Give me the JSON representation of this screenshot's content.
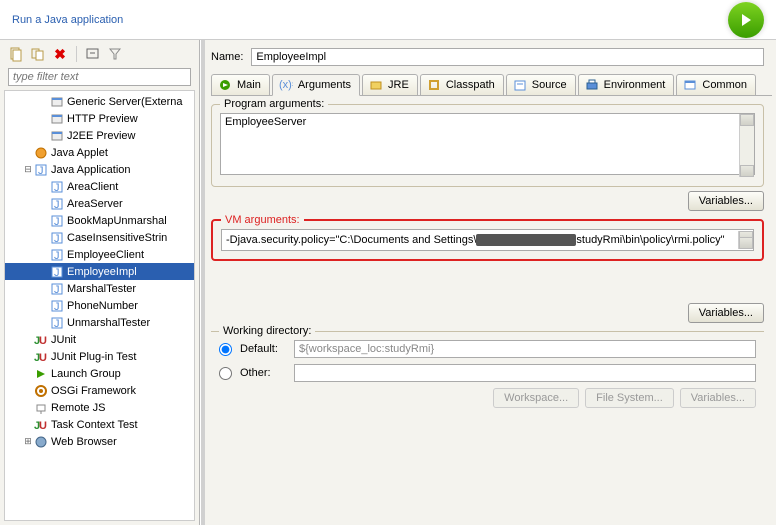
{
  "header": {
    "title": "Run a Java application"
  },
  "filter_placeholder": "type filter text",
  "tree": [
    {
      "label": "Generic Server(Externa",
      "depth": 2,
      "icon": "server"
    },
    {
      "label": "HTTP Preview",
      "depth": 2,
      "icon": "server"
    },
    {
      "label": "J2EE Preview",
      "depth": 2,
      "icon": "server"
    },
    {
      "label": "Java Applet",
      "depth": 1,
      "icon": "applet",
      "exp": ""
    },
    {
      "label": "Java Application",
      "depth": 1,
      "icon": "javaapp",
      "exp": "-"
    },
    {
      "label": "AreaClient",
      "depth": 2,
      "icon": "javarun"
    },
    {
      "label": "AreaServer",
      "depth": 2,
      "icon": "javarun"
    },
    {
      "label": "BookMapUnmarshal",
      "depth": 2,
      "icon": "javarun"
    },
    {
      "label": "CaseInsensitiveStrin",
      "depth": 2,
      "icon": "javarun"
    },
    {
      "label": "EmployeeClient",
      "depth": 2,
      "icon": "javarun"
    },
    {
      "label": "EmployeeImpl",
      "depth": 2,
      "icon": "javarun",
      "sel": true
    },
    {
      "label": "MarshalTester",
      "depth": 2,
      "icon": "javarun"
    },
    {
      "label": "PhoneNumber",
      "depth": 2,
      "icon": "javarun"
    },
    {
      "label": "UnmarshalTester",
      "depth": 2,
      "icon": "javarun"
    },
    {
      "label": "JUnit",
      "depth": 1,
      "icon": "junit",
      "exp": ""
    },
    {
      "label": "JUnit Plug-in Test",
      "depth": 1,
      "icon": "junit",
      "exp": ""
    },
    {
      "label": "Launch Group",
      "depth": 1,
      "icon": "launch",
      "exp": ""
    },
    {
      "label": "OSGi Framework",
      "depth": 1,
      "icon": "osgi",
      "exp": ""
    },
    {
      "label": "Remote JS",
      "depth": 1,
      "icon": "remote",
      "exp": ""
    },
    {
      "label": "Task Context Test",
      "depth": 1,
      "icon": "task",
      "exp": ""
    },
    {
      "label": "Web Browser",
      "depth": 1,
      "icon": "browser",
      "exp": "+"
    }
  ],
  "form": {
    "name_label": "Name:",
    "name_value": "EmployeeImpl",
    "tabs": [
      "Main",
      "Arguments",
      "JRE",
      "Classpath",
      "Source",
      "Environment",
      "Common"
    ],
    "active_tab": 1,
    "program_args_label": "Program arguments:",
    "program_args_value": "EmployeeServer",
    "vm_args_label": "VM arguments:",
    "vm_args_prefix": "-Djava.security.policy=\"C:\\Documents and Settings\\",
    "vm_args_suffix": "studyRmi\\bin\\policy\\rmi.policy\"",
    "variables_btn": "Variables...",
    "wd_label": "Working directory:",
    "wd_default": "Default:",
    "wd_default_value": "${workspace_loc:studyRmi}",
    "wd_other": "Other:",
    "workspace_btn": "Workspace...",
    "filesys_btn": "File System...",
    "vars_btn": "Variables..."
  }
}
